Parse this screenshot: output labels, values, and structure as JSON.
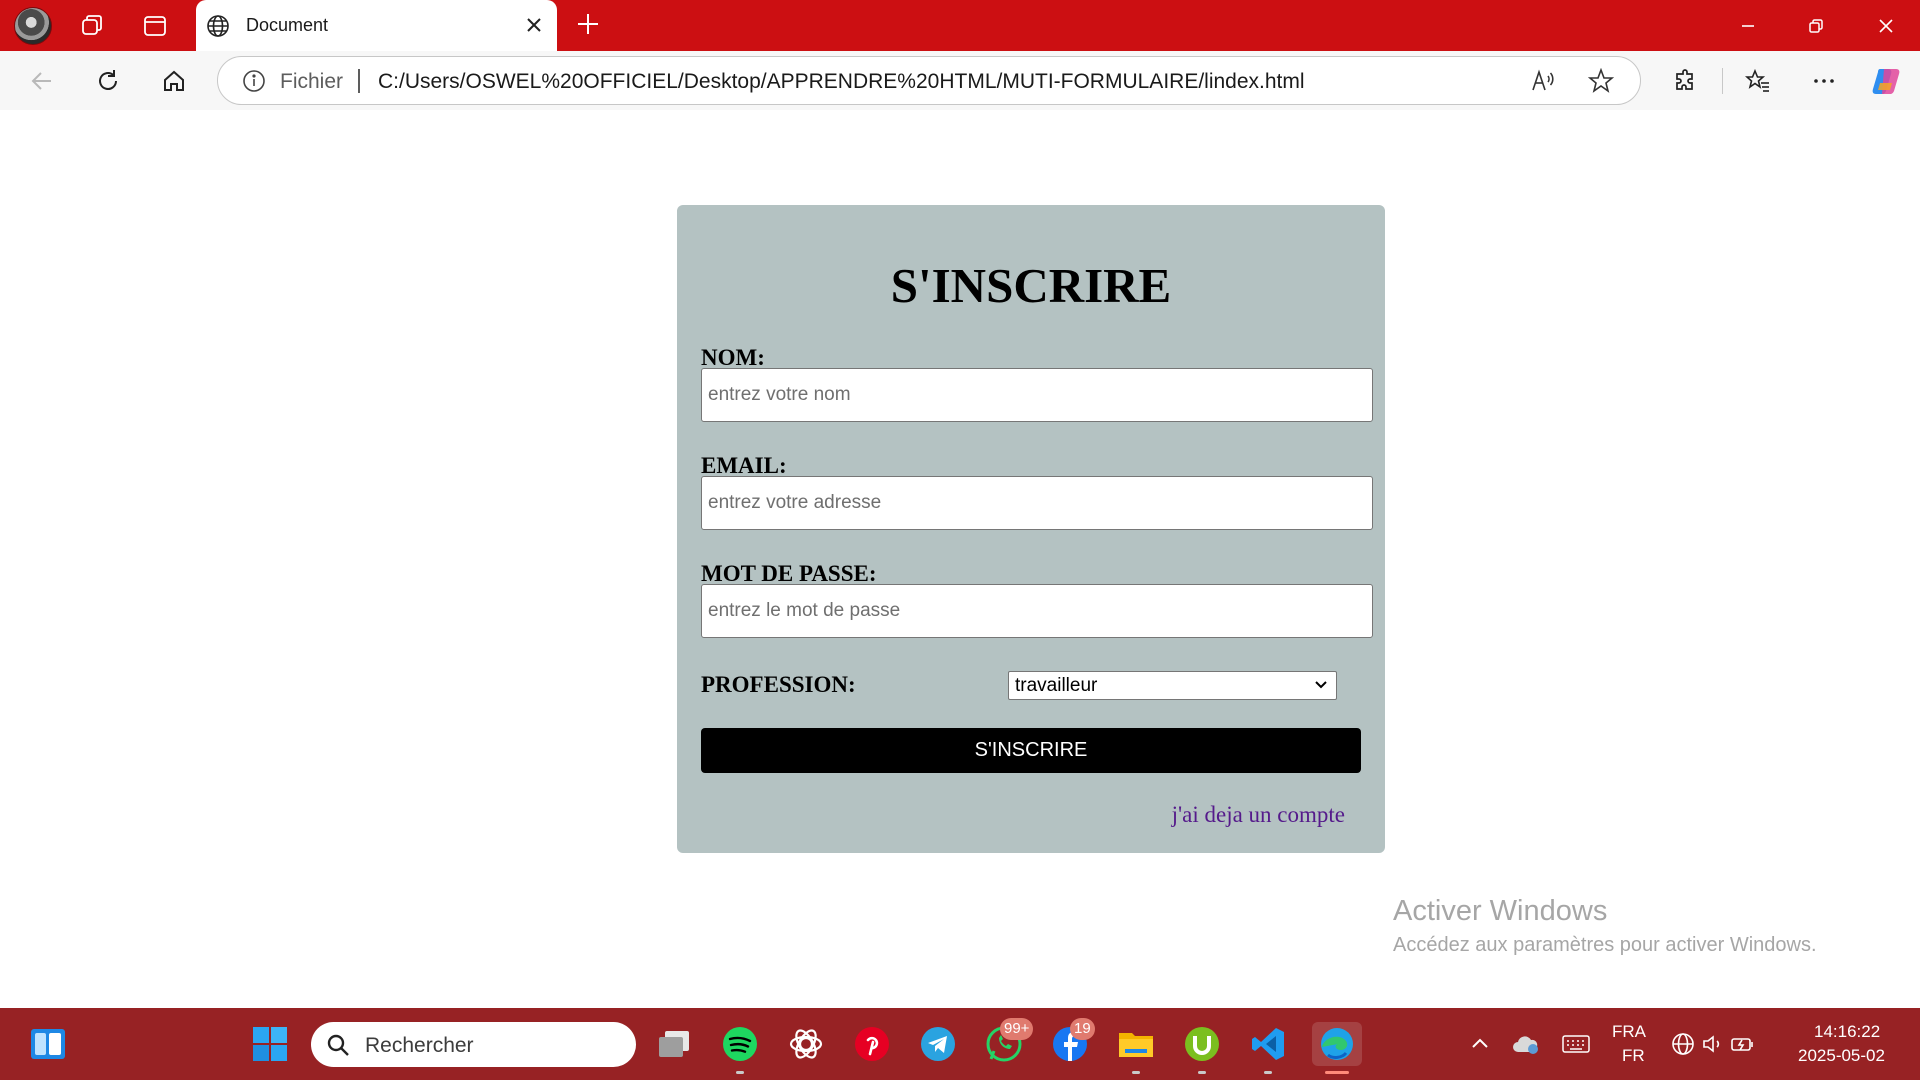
{
  "browser": {
    "tab": {
      "title": "Document"
    },
    "address": {
      "scheme_label": "Fichier",
      "url": "C:/Users/OSWEL%20OFFICIEL/Desktop/APPRENDRE%20HTML/MUTI-FORMULAIRE/lindex.html"
    },
    "accent_color": "#cc0f12"
  },
  "form": {
    "title": "S'INSCRIRE",
    "fields": [
      {
        "label": "NOM:",
        "placeholder": "entrez votre nom"
      },
      {
        "label": "EMAIL:",
        "placeholder": "entrez votre adresse"
      },
      {
        "label": "MOT DE PASSE:",
        "placeholder": "entrez le mot de passe"
      }
    ],
    "profession": {
      "label": "PROFESSION:",
      "selected": "travailleur"
    },
    "submit_label": "S'INSCRIRE",
    "login_link": "j'ai deja un compte",
    "card_color": "#b4c2c2"
  },
  "watermark": {
    "title": "Activer Windows",
    "subtitle": "Accédez aux paramètres pour activer Windows."
  },
  "taskbar": {
    "search_placeholder": "Rechercher",
    "whatsapp_badge": "99+",
    "facebook_badge": "19",
    "language": "FRA",
    "keyboard": "FR",
    "time": "14:16:22",
    "date": "2025-05-02"
  }
}
